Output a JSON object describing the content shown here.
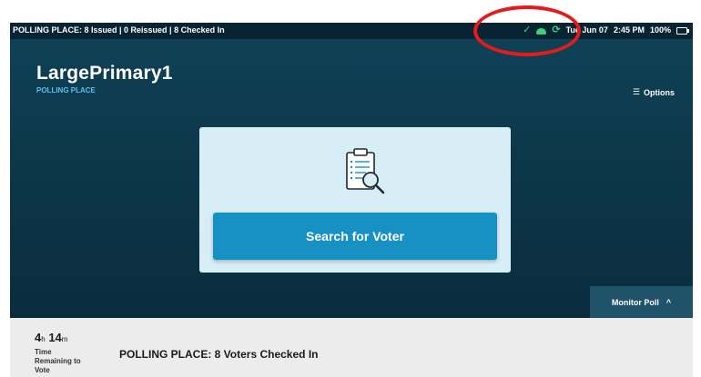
{
  "status_bar": {
    "left_text": "POLLING PLACE: 8 Issued | 0 Reissued | 8 Checked In",
    "icons": [
      "check-icon",
      "cloud-icon",
      "sync-icon",
      "battery-icon"
    ],
    "date": "Tue Jun 07",
    "time": "2:45 PM",
    "battery": "100%"
  },
  "header": {
    "title": "LargePrimary1",
    "subtitle": "POLLING PLACE",
    "options_label": "Options"
  },
  "main": {
    "search_button_label": "Search for Voter"
  },
  "monitor_poll": {
    "label": "Monitor Poll",
    "chevron": "^"
  },
  "footer": {
    "hours": "4",
    "hours_unit": "h",
    "minutes": "14",
    "minutes_unit": "m",
    "time_remaining_label": "Time Remaining to Vote",
    "checked_in_text": "POLLING PLACE: 8 Voters Checked In"
  },
  "colors": {
    "background": "#0f4257",
    "accent": "#1791c4",
    "status_ok": "#3ed17a",
    "annotation": "#e31b1b"
  }
}
